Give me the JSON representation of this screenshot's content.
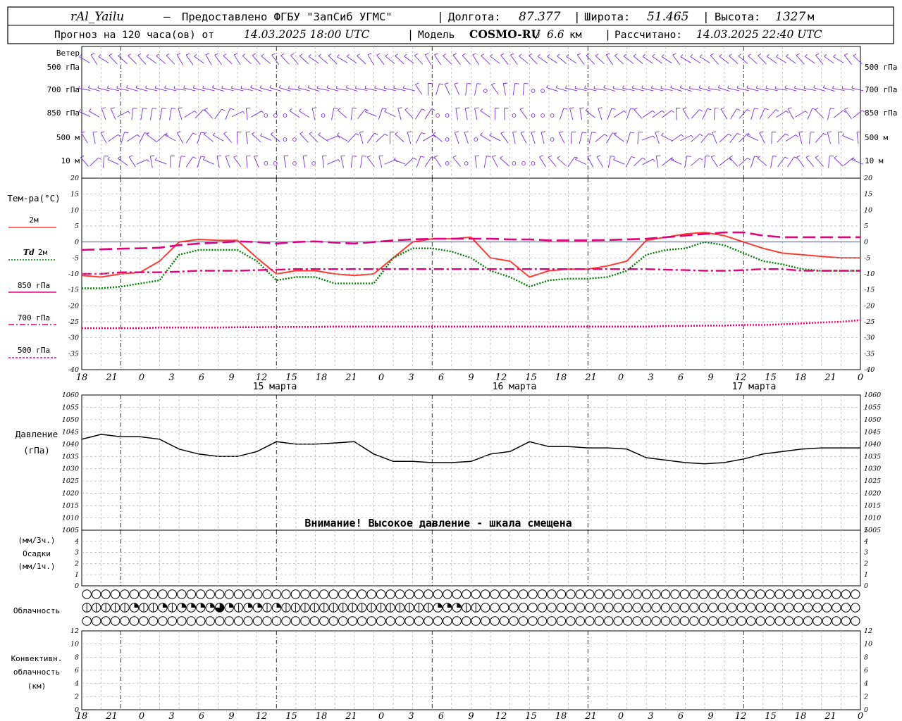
{
  "header": {
    "station": "rAl_Yailu",
    "provider": "Предоставлено ФГБУ \"ЗапСиб УГМС\"",
    "lon_label": "Долгота:",
    "lon": "87.377",
    "lat_label": "Широта:",
    "lat": "51.465",
    "alt_label": "Высота:",
    "alt": "1327",
    "alt_unit": "м",
    "forecast_prefix": "Прогноз на 120 часа(ов) от",
    "forecast_start": "14.03.2025 18:00 UTC",
    "model_label": "Модель",
    "model": "COSMO-RU",
    "resolution": "6.6",
    "res_unit": "км",
    "calc_label": "Рассчитано:",
    "calc_time": "14.03.2025 22:40 UTC"
  },
  "wind": {
    "title": "Ветер",
    "levels": [
      "500 гПа",
      "700 гПа",
      "850 гПа",
      "500 м",
      "10 м"
    ]
  },
  "time_axis": {
    "hour_labels": [
      "18",
      "21",
      "0",
      "3",
      "6",
      "9",
      "12",
      "15",
      "18",
      "21",
      "0",
      "3",
      "6",
      "9",
      "12",
      "15",
      "18",
      "21",
      "0",
      "3",
      "6",
      "9",
      "12",
      "15",
      "18",
      "21",
      "0"
    ],
    "day_labels": [
      "15 марта",
      "16 марта",
      "17 марта"
    ]
  },
  "labels": {
    "temp_title": "Тем-ра(°C)",
    "t2m": "2м",
    "td_sym": "Td",
    "td2m": "2м",
    "t850": "850 гПа",
    "t700": "700 гПа",
    "t500": "500 гПа",
    "press_title": "Давление",
    "press_unit": "(гПа)",
    "press_warning": "Внимание! Высокое давление - шкала смещена",
    "precip_unit3": "(мм/3ч.)",
    "precip_title": "Осадки",
    "precip_unit1": "(мм/1ч.)",
    "cloud_title": "Облачность",
    "conv_title1": "Конвективн.",
    "conv_title2": "облачность",
    "conv_unit": "(км)"
  },
  "colors": {
    "t2m": "#ff3b30",
    "td": "#008000",
    "magenta": "#e6007e",
    "wind": "#7b2be2",
    "grid": "#b0b0b0"
  },
  "chart_data": [
    {
      "type": "line",
      "name": "temperature",
      "x_hours": [
        0,
        3,
        6,
        9,
        12,
        15,
        18,
        21,
        24,
        27,
        30,
        33,
        36,
        39,
        42,
        45,
        48,
        51,
        54,
        57,
        60,
        63,
        66,
        69,
        72,
        75,
        78,
        81,
        84,
        87,
        90,
        93,
        96,
        99,
        102,
        105,
        108,
        111,
        114,
        117,
        120
      ],
      "ylim": [
        -40,
        20
      ],
      "yticks": [
        20,
        15,
        10,
        5,
        0,
        -5,
        -10,
        -15,
        -20,
        -25,
        -30,
        -35,
        -40
      ],
      "series": [
        {
          "name": "2м",
          "style": "solid",
          "values": [
            -10.5,
            -11,
            -10,
            -9.5,
            -6,
            0,
            0.8,
            0.5,
            0.5,
            -5,
            -10,
            -9,
            -9,
            -10,
            -10.5,
            -10,
            -5,
            0,
            1,
            1,
            1.5,
            -5,
            -6,
            -11,
            -9,
            -8.5,
            -8.5,
            -7.5,
            -6,
            0.5,
            1.5,
            2.5,
            3,
            2,
            0,
            -2,
            -3.5,
            -4,
            -4.5,
            -5,
            -5
          ]
        },
        {
          "name": "Td 2м",
          "style": "dotted",
          "values": [
            -14.5,
            -14.5,
            -14,
            -13,
            -12,
            -4,
            -2.5,
            -2.5,
            -2.5,
            -6,
            -12,
            -11,
            -11,
            -13,
            -13,
            -13,
            -5,
            -2,
            -2,
            -3,
            -5,
            -9,
            -11,
            -14,
            -12,
            -11.5,
            -11.5,
            -11,
            -9,
            -4,
            -2.5,
            -2,
            0,
            -1,
            -3.5,
            -6,
            -7,
            -8.5,
            -9,
            -9,
            -9
          ]
        },
        {
          "name": "850 гПа",
          "style": "dash",
          "values": [
            -2.5,
            -2.3,
            -2.1,
            -2,
            -1.8,
            -1,
            -0.5,
            -0.2,
            0.2,
            0,
            -0.5,
            0,
            0.2,
            -0.2,
            -0.5,
            0,
            0.5,
            0.8,
            1,
            1,
            1,
            1,
            0.8,
            0.8,
            0.5,
            0.5,
            0.5,
            0.6,
            0.8,
            1,
            1.5,
            2,
            2.5,
            3,
            3,
            2,
            1.5,
            1.5,
            1.5,
            1.5,
            1.5
          ]
        },
        {
          "name": "700 гПа",
          "style": "dashdot",
          "values": [
            -10,
            -10,
            -9.5,
            -9.5,
            -9.5,
            -9.3,
            -9,
            -9,
            -9,
            -8.8,
            -8.7,
            -8.5,
            -8.5,
            -8.5,
            -8.5,
            -8.5,
            -8.5,
            -8.5,
            -8.5,
            -8.5,
            -8.5,
            -8.5,
            -8.5,
            -8.5,
            -8.5,
            -8.5,
            -8.5,
            -8.5,
            -8.5,
            -8.5,
            -8.7,
            -8.8,
            -9,
            -9,
            -8.8,
            -8.5,
            -8.5,
            -9,
            -9,
            -9,
            -9
          ]
        },
        {
          "name": "500 гПа",
          "style": "dotted",
          "values": [
            -27,
            -27,
            -27,
            -27,
            -26.8,
            -26.8,
            -26.8,
            -26.8,
            -26.7,
            -26.7,
            -26.6,
            -26.6,
            -26.6,
            -26.5,
            -26.5,
            -26.5,
            -26.5,
            -26.5,
            -26.5,
            -26.5,
            -26.5,
            -26.5,
            -26.5,
            -26.5,
            -26.5,
            -26.5,
            -26.5,
            -26.5,
            -26.5,
            -26.5,
            -26.3,
            -26.3,
            -26.2,
            -26.2,
            -26,
            -26,
            -25.8,
            -25.5,
            -25.2,
            -25,
            -24.5
          ]
        }
      ]
    },
    {
      "type": "line",
      "name": "pressure",
      "x_hours": [
        0,
        3,
        6,
        9,
        12,
        15,
        18,
        21,
        24,
        27,
        30,
        33,
        36,
        39,
        42,
        45,
        48,
        51,
        54,
        57,
        60,
        63,
        66,
        69,
        72,
        75,
        78,
        81,
        84,
        87,
        90,
        93,
        96,
        99,
        102,
        105,
        108,
        111,
        114,
        117,
        120
      ],
      "ylim": [
        1005,
        1060
      ],
      "yticks": [
        1060,
        1055,
        1050,
        1045,
        1040,
        1035,
        1030,
        1025,
        1020,
        1015,
        1010,
        1005
      ],
      "values": [
        1042,
        1044,
        1043,
        1043,
        1042,
        1038,
        1036,
        1035,
        1035,
        1037,
        1041,
        1040,
        1040,
        1040.5,
        1041,
        1036,
        1033,
        1033,
        1032.5,
        1032.5,
        1033,
        1036,
        1037,
        1041,
        1039,
        1039,
        1038.5,
        1038.5,
        1038,
        1034.5,
        1033.5,
        1032.5,
        1032,
        1032.5,
        1034,
        1036,
        1037,
        1038,
        1038.5,
        1038.5,
        1038.5
      ]
    },
    {
      "type": "bar",
      "name": "precipitation",
      "ylim": [
        0,
        5
      ],
      "yticks": [
        5,
        4,
        3,
        2,
        1,
        0
      ],
      "values": []
    },
    {
      "type": "table",
      "name": "cloud_cover",
      "rows": 3,
      "columns": 82,
      "middle_row_partial": [
        [
          0,
          1
        ],
        [
          1,
          1
        ],
        [
          2,
          1
        ],
        [
          3,
          1
        ],
        [
          4,
          1
        ],
        [
          5,
          2
        ],
        [
          6,
          1
        ],
        [
          7,
          1
        ],
        [
          8,
          2
        ],
        [
          9,
          1
        ],
        [
          10,
          2
        ],
        [
          11,
          2
        ],
        [
          12,
          2
        ],
        [
          13,
          2
        ],
        [
          14,
          3
        ],
        [
          15,
          2
        ],
        [
          16,
          1
        ],
        [
          17,
          2
        ],
        [
          18,
          2
        ],
        [
          19,
          1
        ],
        [
          20,
          2
        ],
        [
          21,
          1
        ],
        [
          22,
          1
        ],
        [
          23,
          1
        ],
        [
          24,
          1
        ],
        [
          25,
          1
        ],
        [
          26,
          1
        ],
        [
          27,
          1
        ],
        [
          28,
          1
        ],
        [
          29,
          1
        ],
        [
          30,
          1
        ],
        [
          31,
          1
        ],
        [
          32,
          1
        ],
        [
          33,
          1
        ],
        [
          34,
          1
        ],
        [
          35,
          1
        ],
        [
          36,
          1
        ],
        [
          37,
          2
        ],
        [
          38,
          2
        ],
        [
          39,
          2
        ],
        [
          40,
          1
        ],
        [
          41,
          1
        ]
      ]
    },
    {
      "type": "bar",
      "name": "convective_cloud",
      "ylim": [
        0,
        12
      ],
      "yticks": [
        12,
        10,
        8,
        6,
        4,
        2,
        0
      ],
      "values": []
    }
  ]
}
